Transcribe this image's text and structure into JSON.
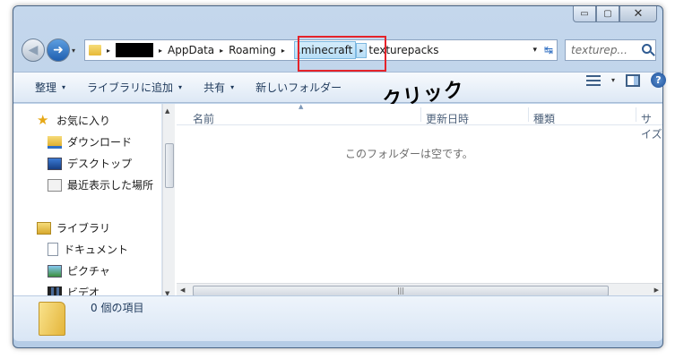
{
  "window": {
    "controls": {
      "minimize": "▭",
      "maximize": "▢",
      "close": "✕"
    }
  },
  "nav": {
    "back_icon": "back-arrow-icon",
    "forward_icon": "forward-arrow-icon",
    "back_glyph": "◀",
    "forward_glyph": "➜",
    "dropdown": "▾"
  },
  "address": {
    "crumbs": [
      "AppData",
      "Roaming",
      ".minecraft",
      "texturepacks"
    ],
    "separator": "▸",
    "dropdown": "▾",
    "refresh": "↹"
  },
  "search": {
    "placeholder": "texturep..."
  },
  "toolbar": {
    "organize": "整理",
    "include_library": "ライブラリに追加",
    "share": "共有",
    "new_folder": "新しいフォルダー",
    "caret": "▾",
    "help": "?"
  },
  "annotation": {
    "click_label": "クリック",
    "highlight_color": "#e5232a"
  },
  "sidebar": {
    "favorites": "お気に入り",
    "downloads": "ダウンロード",
    "desktop": "デスクトップ",
    "recent": "最近表示した場所",
    "libraries": "ライブラリ",
    "documents": "ドキュメント",
    "pictures": "ピクチャ",
    "videos": "ビデオ"
  },
  "columns": {
    "name": "名前",
    "modified": "更新日時",
    "type": "種類",
    "size": "サイズ"
  },
  "file_area": {
    "empty_message": "このフォルダーは空です。"
  },
  "status": {
    "items": "0 個の項目"
  }
}
